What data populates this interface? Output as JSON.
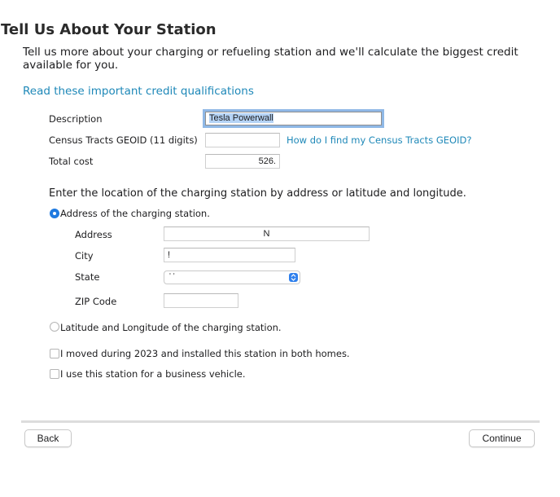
{
  "page": {
    "title": "Tell Us About Your Station",
    "intro": "Tell us more about your charging or refueling station and we'll calculate the biggest credit available for you.",
    "qualifications_link": "Read these important credit qualifications"
  },
  "form": {
    "description": {
      "label": "Description",
      "value": "Tesla Powerwall"
    },
    "census": {
      "label": "Census Tracts GEOID (11 digits)",
      "value": "",
      "help_link": "How do I find my Census Tracts GEOID?"
    },
    "total_cost": {
      "label": "Total cost",
      "value": "526."
    }
  },
  "location": {
    "heading": "Enter the location of the charging station by address or latitude and longitude.",
    "option_address": {
      "label": "Address of the charging station.",
      "selected": true
    },
    "address": {
      "label": "Address",
      "value": "N"
    },
    "city": {
      "label": "City",
      "value": "!"
    },
    "state": {
      "label": "State",
      "value": "' '"
    },
    "zip": {
      "label": "ZIP Code",
      "value": ""
    },
    "option_latlong": {
      "label": "Latitude and Longitude of the charging station.",
      "selected": false
    }
  },
  "checkboxes": {
    "moved": {
      "label": "I moved during 2023 and installed this station in both homes.",
      "checked": false
    },
    "business": {
      "label": "I use this station for a business vehicle.",
      "checked": false
    }
  },
  "footer": {
    "back_label": "Back",
    "continue_label": "Continue"
  },
  "colors": {
    "accent": "#1f7ae0",
    "link": "#1e88b8",
    "focus_ring": "#8fb8e6"
  }
}
